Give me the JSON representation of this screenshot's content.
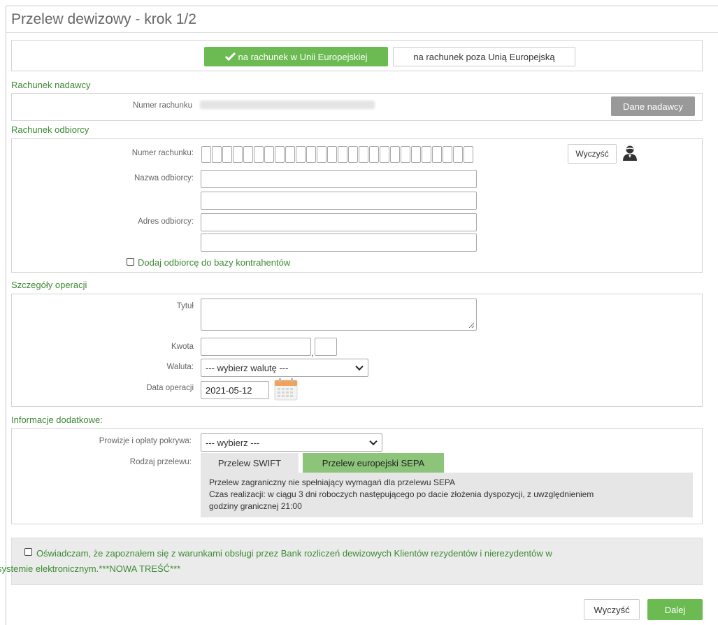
{
  "page": {
    "title": "Przelew dewizowy - krok 1/2"
  },
  "destination_tabs": {
    "eu_label": "na rachunek w Unii Europejskiej",
    "non_eu_label": "na rachunek poza Unią Europejską"
  },
  "sender": {
    "section_title": "Rachunek nadawcy",
    "account_label": "Numer rachunku",
    "sender_data_button": "Dane nadawcy"
  },
  "recipient": {
    "section_title": "Rachunek odbiorcy",
    "account_label": "Numer rachunku:",
    "clear_button": "Wyczyść",
    "name_label": "Nazwa odbiorcy:",
    "address_label": "Adres odbiorcy:",
    "add_to_db_label": "Dodaj odbiorcę do bazy kontrahentów"
  },
  "operation": {
    "section_title": "Szczegóły operacji",
    "title_label": "Tytuł",
    "amount_label": "Kwota",
    "currency_label": "Waluta:",
    "currency_selected": "--- wybierz walutę ---",
    "date_label": "Data operacji",
    "date_value": "2021-05-12"
  },
  "additional": {
    "section_title": "Informacje dodatkowe:",
    "fees_label": "Prowizje i opłaty pokrywa:",
    "fees_selected": "--- wybierz ---",
    "transfer_type_label": "Rodzaj przelewu:",
    "swift_tab": "Przelew SWIFT",
    "sepa_tab": "Przelew europejski SEPA",
    "info_line1": "Przelew zagraniczny nie spełniający wymagań dla przelewu SEPA",
    "info_line2": "Czas realizacji: w ciągu 3 dni roboczych następującego po dacie złożenia dyspozycji, z uwzględnieniem",
    "info_line3": "godziny granicznej 21:00"
  },
  "declaration": {
    "line1": "Oświadczam, że zapoznałem się z warunkami obsługi przez Bank rozliczeń dewizowych Klientów rezydentów i nierezydentów w",
    "line2": "systemie elektronicznym.***NOWA TREŚĆ***"
  },
  "footer": {
    "clear_button": "Wyczyść",
    "next_button": "Dalej"
  },
  "colors": {
    "accent_green": "#6cbb52",
    "section_green": "#3d8a34",
    "gray_button": "#999999",
    "info_bg": "#e6e6e6"
  }
}
